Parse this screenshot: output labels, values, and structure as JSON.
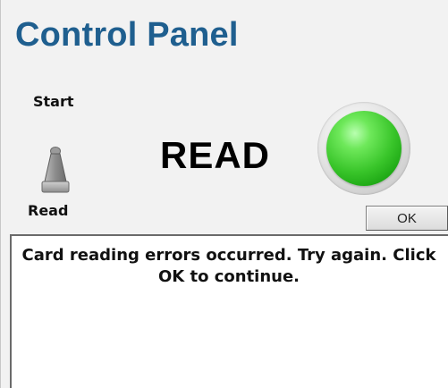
{
  "window": {
    "title": "Control Panel"
  },
  "switch": {
    "top_label": "Start",
    "bottom_label": "Read",
    "icon": "toggle-switch-icon"
  },
  "status": {
    "text": "READ",
    "indicator": {
      "state": "on",
      "color": "#33c026",
      "icon": "green-led-indicator"
    }
  },
  "dialog": {
    "ok_label": "OK",
    "message": "Card reading errors occurred.  Try again.  Click OK to continue."
  },
  "colors": {
    "title": "#1f5f8f",
    "panel_bg": "#f2f2f2",
    "message_bg": "#ffffff"
  }
}
